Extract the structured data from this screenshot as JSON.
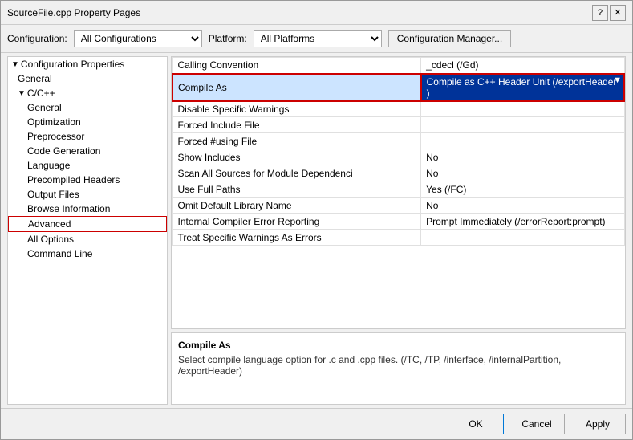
{
  "dialog": {
    "title": "SourceFile.cpp Property Pages",
    "help_btn": "?",
    "close_btn": "✕"
  },
  "config_bar": {
    "config_label": "Configuration:",
    "config_value": "All Configurations",
    "platform_label": "Platform:",
    "platform_value": "All Platforms",
    "manager_btn": "Configuration Manager..."
  },
  "tree": [
    {
      "id": "config-props",
      "label": "Configuration Properties",
      "indent": 0,
      "expanded": true,
      "icon": "▼"
    },
    {
      "id": "general",
      "label": "General",
      "indent": 1,
      "selected": false
    },
    {
      "id": "cpp",
      "label": "C/C++",
      "indent": 1,
      "expanded": true,
      "icon": "▼"
    },
    {
      "id": "general2",
      "label": "General",
      "indent": 2
    },
    {
      "id": "optimization",
      "label": "Optimization",
      "indent": 2
    },
    {
      "id": "preprocessor",
      "label": "Preprocessor",
      "indent": 2
    },
    {
      "id": "code-gen",
      "label": "Code Generation",
      "indent": 2
    },
    {
      "id": "language",
      "label": "Language",
      "indent": 2
    },
    {
      "id": "precompiled",
      "label": "Precompiled Headers",
      "indent": 2
    },
    {
      "id": "output-files",
      "label": "Output Files",
      "indent": 2
    },
    {
      "id": "browse-info",
      "label": "Browse Information",
      "indent": 2
    },
    {
      "id": "advanced",
      "label": "Advanced",
      "indent": 2,
      "active_border": true
    },
    {
      "id": "all-options",
      "label": "All Options",
      "indent": 2
    },
    {
      "id": "command-line",
      "label": "Command Line",
      "indent": 2
    }
  ],
  "properties": [
    {
      "name": "Calling Convention",
      "value": "_cdecl (/Gd)"
    },
    {
      "name": "Compile As",
      "value": "Compile as C++ Header Unit (/exportHeader )",
      "highlighted": true
    },
    {
      "name": "Disable Specific Warnings",
      "value": ""
    },
    {
      "name": "Forced Include File",
      "value": ""
    },
    {
      "name": "Forced #using File",
      "value": ""
    },
    {
      "name": "Show Includes",
      "value": "No"
    },
    {
      "name": "Scan All Sources for Module Dependenci",
      "value": "No"
    },
    {
      "name": "Use Full Paths",
      "value": "Yes (/FC)"
    },
    {
      "name": "Omit Default Library Name",
      "value": "No"
    },
    {
      "name": "Internal Compiler Error Reporting",
      "value": "Prompt Immediately (/errorReport:prompt)"
    },
    {
      "name": "Treat Specific Warnings As Errors",
      "value": ""
    }
  ],
  "info": {
    "title": "Compile As",
    "description": "Select compile language option for .c and .cpp files.   (/TC, /TP, /interface, /internalPartition, /exportHeader)"
  },
  "buttons": {
    "ok": "OK",
    "cancel": "Cancel",
    "apply": "Apply"
  }
}
